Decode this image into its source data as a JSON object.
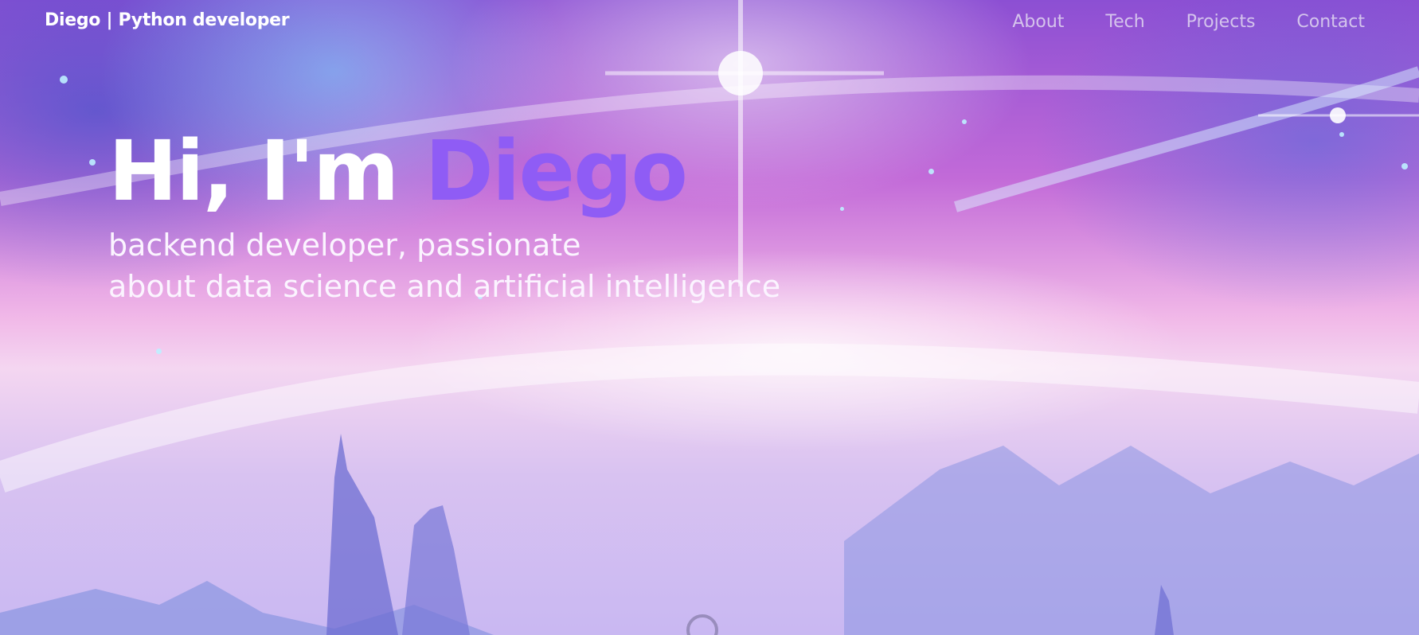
{
  "header": {
    "brand": "Diego  | Python developer",
    "nav": [
      "About",
      "Tech",
      "Projects",
      "Contact"
    ]
  },
  "hero": {
    "greeting": "Hi, I'm ",
    "name": "Diego",
    "subtitle_line1": "backend developer, passionate",
    "subtitle_line2": "about data science and artificial intelligence"
  },
  "colors": {
    "accent": "#8f5cf5",
    "text": "#ffffff",
    "nav_text": "#e1d7f0"
  },
  "icons": {
    "scroll": "scroll-down-indicator-icon"
  }
}
